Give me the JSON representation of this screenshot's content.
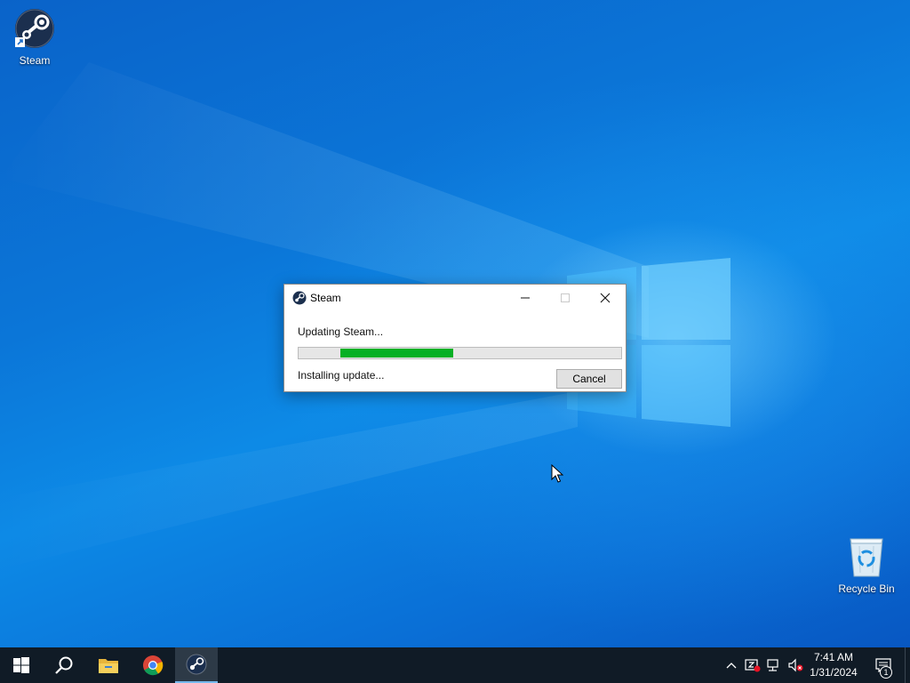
{
  "desktop": {
    "icons": [
      {
        "label": "Steam",
        "icon": "steam-icon"
      },
      {
        "label": "Recycle Bin",
        "icon": "recycle-bin-icon"
      }
    ]
  },
  "dialog": {
    "title": "Steam",
    "status": "Updating Steam...",
    "detail": "Installing update...",
    "cancel_label": "Cancel",
    "progress": {
      "start_fraction": 0.13,
      "end_fraction": 0.48,
      "color": "#06b025"
    }
  },
  "taskbar": {
    "items": [
      {
        "icon": "windows-start-icon"
      },
      {
        "icon": "search-icon"
      },
      {
        "icon": "file-explorer-icon"
      },
      {
        "icon": "chrome-icon"
      },
      {
        "icon": "steam-icon",
        "active": true
      }
    ],
    "tray_icons": [
      "chevron-up-icon",
      "security-alert-icon",
      "network-icon",
      "volume-muted-icon"
    ],
    "time": "7:41 AM",
    "date": "1/31/2024",
    "notification_count": "1"
  },
  "colors": {
    "accent": "#0078d7",
    "taskbar": "#101b26",
    "progress": "#06b025"
  }
}
